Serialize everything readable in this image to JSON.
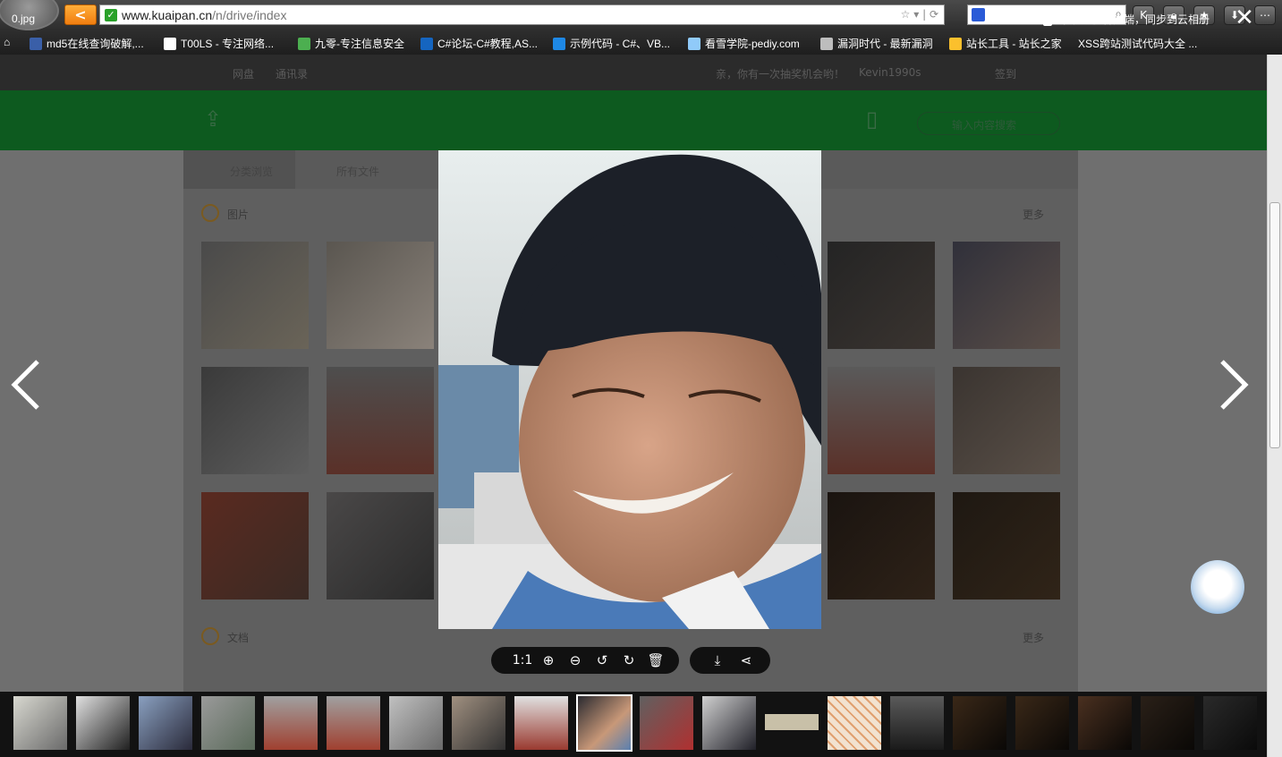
{
  "browser": {
    "back_label": "<",
    "url_host": "www.kuaipan.cn",
    "url_path": "/n/drive/index"
  },
  "bookmarks": [
    {
      "label": "md5在线查询破解,...",
      "icon_color": "#3a5fa8"
    },
    {
      "label": "T00LS - 专注网络...",
      "icon_color": "#ffffff"
    },
    {
      "label": "九零-专注信息安全",
      "icon_color": "#4caf50"
    },
    {
      "label": "C#论坛-C#教程,AS...",
      "icon_color": "#1565c0"
    },
    {
      "label": "示例代码 - C#、VB...",
      "icon_color": "#1e88e5"
    },
    {
      "label": "看雪学院-pediy.com",
      "icon_color": "#90caf9"
    },
    {
      "label": "漏洞时代 - 最新漏洞",
      "icon_color": "#bdbdbd"
    },
    {
      "label": "站长工具 - 站长之家",
      "icon_color": "#fbc02d"
    },
    {
      "label": "XSS跨站测试代码大全 ..."
    }
  ],
  "page_bg": {
    "nav_drive": "网盘",
    "nav_contacts": "通讯录",
    "lottery_msg": "亲，你有一次抽奖机会哟！",
    "username": "Kevin1990s",
    "checkin": "签到",
    "search_placeholder": "输入内容搜索",
    "tab_category": "分类浏览",
    "tab_all_files": "所有文件",
    "section_images": "图片",
    "section_docs": "文档",
    "more": "更多"
  },
  "viewer": {
    "filename": "0.jpg",
    "promo": "下载手机客户端，同步到云相册",
    "close_symbol": "✕",
    "prev_symbol": "‹",
    "next_symbol": "›",
    "tools": {
      "actual_size": "1:1"
    }
  },
  "colors": {
    "accent_green": "#1a8d36",
    "dim_overlay": "rgba(0,0,0,0.55)"
  },
  "icons": [
    "back-arrow-icon",
    "secure-check-icon",
    "star-icon",
    "refresh-icon",
    "search-icon",
    "zoom-in-icon",
    "zoom-out-icon",
    "rotate-left-icon",
    "rotate-right-icon",
    "trash-icon",
    "download-icon",
    "share-icon",
    "close-icon",
    "upload-icon",
    "phone-icon",
    "kuaipan-bird-icon"
  ]
}
